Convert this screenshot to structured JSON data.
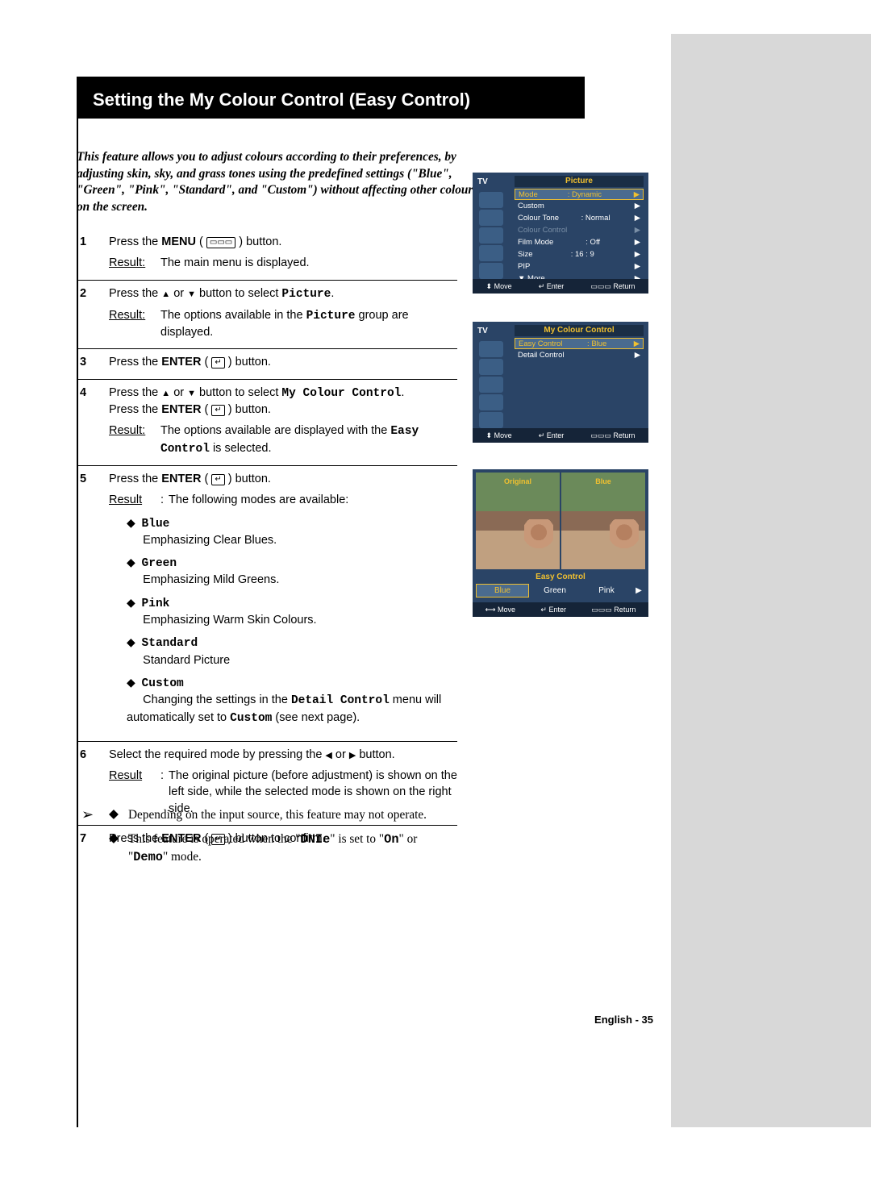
{
  "title": "Setting the My Colour Control (Easy Control)",
  "intro": "This feature allows you to adjust colours according to their preferences, by adjusting skin, sky, and grass tones using the predefined settings (\"Blue\", \"Green\", \"Pink\", \"Standard\", and \"Custom\") without affecting other colours on the screen.",
  "steps": [
    {
      "num": "1",
      "text_a": "Press the ",
      "bold_a": "MENU",
      "text_b": " ( ",
      "icon_a": "▭▭▭",
      "text_c": " ) button.",
      "result": "The main menu is displayed."
    },
    {
      "num": "2",
      "text_a": "Press the ",
      "tri_a": "▲",
      "text_b": " or ",
      "tri_b": "▼",
      "text_c": " button to select ",
      "mono_a": "Picture",
      "text_d": ".",
      "result_a": "The options available in the ",
      "result_mono": "Picture",
      "result_b": " group are displayed."
    },
    {
      "num": "3",
      "text_a": "Press the ",
      "bold_a": "ENTER",
      "text_b": " ( ",
      "icon_a": "↵",
      "text_c": " ) button."
    },
    {
      "num": "4",
      "text_a": "Press the ",
      "tri_a": "▲",
      "text_b": " or ",
      "tri_b": "▼",
      "text_c": " button to select ",
      "mono_a": "My Colour Control",
      "text_d": ".",
      "line2_a": "Press the ",
      "line2_bold": "ENTER",
      "line2_b": " ( ",
      "line2_icon": "↵",
      "line2_c": " ) button.",
      "result_a": "The options available are displayed with the ",
      "result_mono": "Easy Control",
      "result_b": " is selected."
    },
    {
      "num": "5",
      "text_a": "Press the ",
      "bold_a": "ENTER",
      "text_b": " ( ",
      "icon_a": "↵",
      "text_c": " ) button.",
      "result": "The following modes are available:",
      "modes": [
        {
          "name": "Blue",
          "desc": "Emphasizing Clear Blues."
        },
        {
          "name": "Green",
          "desc": "Emphasizing Mild Greens."
        },
        {
          "name": "Pink",
          "desc": "Emphasizing Warm Skin Colours."
        },
        {
          "name": "Standard",
          "desc": "Standard Picture"
        },
        {
          "name": "Custom",
          "desc_a": "Changing the settings in the ",
          "desc_mono1": "Detail Control",
          "desc_b": " menu will automatically set to ",
          "desc_mono2": "Custom",
          "desc_c": " (see next page)."
        }
      ]
    },
    {
      "num": "6",
      "text_a": "Select the required mode by pressing the ",
      "tri_a": "◀",
      "text_b": " or ",
      "tri_b": "▶",
      "text_c": " button.",
      "result": "The original picture (before adjustment) is shown on the left side, while the selected mode is shown on the right side."
    },
    {
      "num": "7",
      "text_a": "Press the ",
      "bold_a": "ENTER",
      "text_b": " ( ",
      "icon_a": "↵",
      "text_c": " ) button to confirm."
    }
  ],
  "notes": [
    {
      "text": "Depending on the input source, this feature may not operate."
    },
    {
      "text_a": "This feature is operated when the \"",
      "mono_a": "DNIe",
      "text_b": "\" is set to \"",
      "mono_b": "On",
      "text_c": "\" or \"",
      "mono_c": "Demo",
      "text_d": "\" mode."
    }
  ],
  "osd1": {
    "tv": "TV",
    "head": "Picture",
    "rows": [
      {
        "label": "Mode",
        "val": ": Dynamic",
        "sel": true
      },
      {
        "label": "Custom"
      },
      {
        "label": "Colour Tone",
        "val": ": Normal"
      },
      {
        "label": "Colour Control",
        "dim": true
      },
      {
        "label": "Film Mode",
        "val": ": Off"
      },
      {
        "label": "Size",
        "val": ": 16 : 9"
      },
      {
        "label": "PIP"
      },
      {
        "label": "▼ More"
      }
    ],
    "foot": [
      "⬍ Move",
      "↵ Enter",
      "▭▭▭ Return"
    ]
  },
  "osd2": {
    "tv": "TV",
    "head": "My Colour Control",
    "rows": [
      {
        "label": "Easy Control",
        "val": ": Blue",
        "sel": true
      },
      {
        "label": "Detail Control"
      }
    ],
    "foot": [
      "⬍ Move",
      "↵ Enter",
      "▭▭▭ Return"
    ]
  },
  "preview": {
    "left": "Original",
    "right": "Blue",
    "ec": "Easy Control",
    "opts": [
      "Blue",
      "Green",
      "Pink"
    ],
    "sel": 0,
    "arr": "▶",
    "foot": [
      "⟷ Move",
      "↵ Enter",
      "▭▭▭ Return"
    ]
  },
  "pagefoot": "English - 35"
}
